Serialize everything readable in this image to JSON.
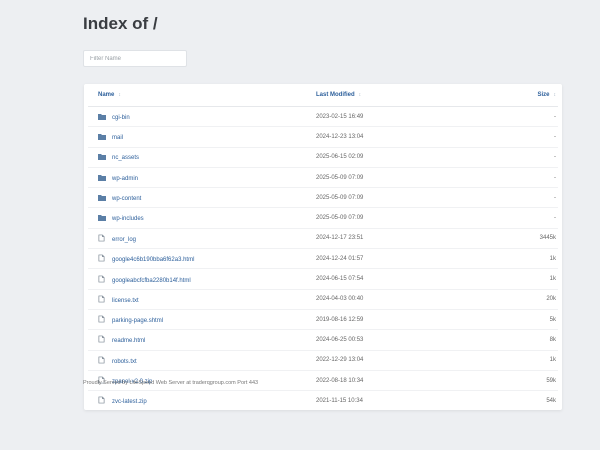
{
  "page": {
    "title": "Index of /"
  },
  "filter": {
    "placeholder": "Filter Name"
  },
  "table": {
    "headers": {
      "name": "Name",
      "modified": "Last Modified",
      "size": "Size"
    },
    "rows": [
      {
        "icon": "folder-icon",
        "name": "cgi-bin",
        "modified": "2023-02-15 16:49",
        "size": "-"
      },
      {
        "icon": "folder-icon",
        "name": "mail",
        "modified": "2024-12-23 13:04",
        "size": "-"
      },
      {
        "icon": "folder-icon",
        "name": "nc_assets",
        "modified": "2025-06-15 02:09",
        "size": "-"
      },
      {
        "icon": "folder-icon",
        "name": "wp-admin",
        "modified": "2025-05-09 07:09",
        "size": "-"
      },
      {
        "icon": "folder-icon",
        "name": "wp-content",
        "modified": "2025-05-09 07:09",
        "size": "-"
      },
      {
        "icon": "folder-icon",
        "name": "wp-includes",
        "modified": "2025-05-09 07:09",
        "size": "-"
      },
      {
        "icon": "file-icon",
        "name": "error_log",
        "modified": "2024-12-17 23:51",
        "size": "3445k"
      },
      {
        "icon": "file-icon",
        "name": "google4c6b190bba6f62a3.html",
        "modified": "2024-12-24 01:57",
        "size": "1k"
      },
      {
        "icon": "file-icon",
        "name": "googleabcfcfba2280b14f.html",
        "modified": "2024-06-15 07:54",
        "size": "1k"
      },
      {
        "icon": "file-icon",
        "name": "license.txt",
        "modified": "2024-04-03 00:40",
        "size": "20k"
      },
      {
        "icon": "file-icon",
        "name": "parking-page.shtml",
        "modified": "2019-08-16 12:59",
        "size": "5k"
      },
      {
        "icon": "file-icon",
        "name": "readme.html",
        "modified": "2024-06-25 00:53",
        "size": "8k"
      },
      {
        "icon": "file-icon",
        "name": "robots.txt",
        "modified": "2022-12-29 13:04",
        "size": "1k"
      },
      {
        "icon": "file-icon",
        "name": "zpanel-v2.0.zip",
        "modified": "2022-08-18 10:34",
        "size": "59k"
      },
      {
        "icon": "file-icon",
        "name": "zvc-latest.zip",
        "modified": "2021-11-15 10:34",
        "size": "54k"
      }
    ]
  },
  "footer": {
    "text": "Proudly Served by LiteSpeed Web Server at traderqgroup.com Port 443"
  },
  "colors": {
    "link": "#2c5f9b",
    "background": "#edeff2",
    "folder": "#5b7fa6",
    "file": "#7f8a96"
  }
}
